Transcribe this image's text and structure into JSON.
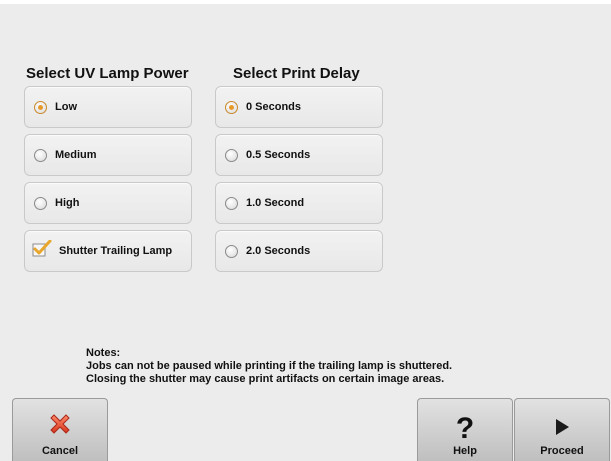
{
  "uv_lamp": {
    "title": "Select UV Lamp Power",
    "options": [
      {
        "label": "Low",
        "selected": true
      },
      {
        "label": "Medium",
        "selected": false
      },
      {
        "label": "High",
        "selected": false
      }
    ],
    "shutter": {
      "label": "Shutter Trailing Lamp",
      "checked": true
    }
  },
  "print_delay": {
    "title": "Select Print Delay",
    "options": [
      {
        "label": "0 Seconds",
        "selected": true
      },
      {
        "label": "0.5 Seconds",
        "selected": false
      },
      {
        "label": "1.0 Second",
        "selected": false
      },
      {
        "label": "2.0 Seconds",
        "selected": false
      }
    ]
  },
  "notes": {
    "heading": "Notes:",
    "line1": "Jobs can not be paused while printing if the trailing lamp is shuttered.",
    "line2": "Closing the shutter may cause print artifacts on certain image areas."
  },
  "buttons": {
    "cancel": "Cancel",
    "help": "Help",
    "proceed": "Proceed"
  },
  "icons": {
    "cancel": "close-icon",
    "help": "question-mark-icon",
    "proceed": "play-arrow-icon",
    "checkbox": "checkmark-icon"
  },
  "colors": {
    "radio_selected": "#e79a2a",
    "cancel_icon": "#e9533a",
    "checkbox_tick": "#e8a72c"
  }
}
